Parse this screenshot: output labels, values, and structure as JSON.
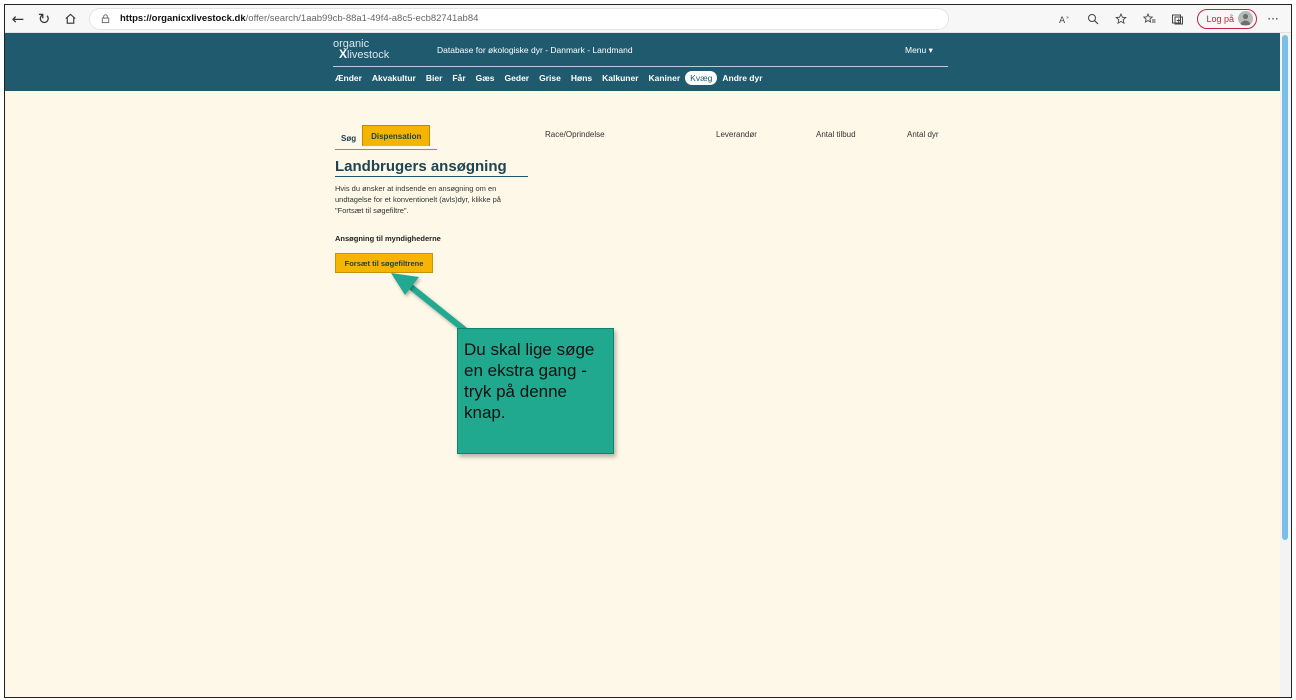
{
  "browser": {
    "url_host": "https://organicxlivestock.dk",
    "url_path": "/offer/search/1aab99cb-88a1-49f4-a8c5-ecb82741ab84",
    "login_label": "Log på"
  },
  "header": {
    "logo_top": "organic",
    "logo_x": "X",
    "logo_bottom": "livestock",
    "db_title": "Database for økologiske dyr - Danmark - Landmand",
    "menu_label": "Menu ▾",
    "animals": [
      "Ænder",
      "Akvakultur",
      "Bier",
      "Får",
      "Gæs",
      "Geder",
      "Grise",
      "Høns",
      "Kalkuner",
      "Kaniner",
      "Kvæg",
      "Andre dyr"
    ],
    "active_animal": "Kvæg"
  },
  "tabs": {
    "search": "Søg",
    "dispensation": "Dispensation"
  },
  "panel": {
    "title": "Landbrugers ansøgning",
    "description": "Hvis du ønsker at indsende en ansøgning om en undtagelse for et konventionelt (avls)dyr, klikke på \"Fortsæt til søgefiltre\".",
    "sub_heading": "Ansøgning til myndighederne",
    "continue_button": "Forsæt til søgefiltrene"
  },
  "columns": {
    "race": "Race/Oprindelse",
    "supplier": "Leverandør",
    "offers": "Antal tilbud",
    "animals": "Antal dyr"
  },
  "annotation": {
    "text": "Du skal lige søge en ekstra gang - tryk på denne knap.",
    "color": "#20a98f"
  }
}
